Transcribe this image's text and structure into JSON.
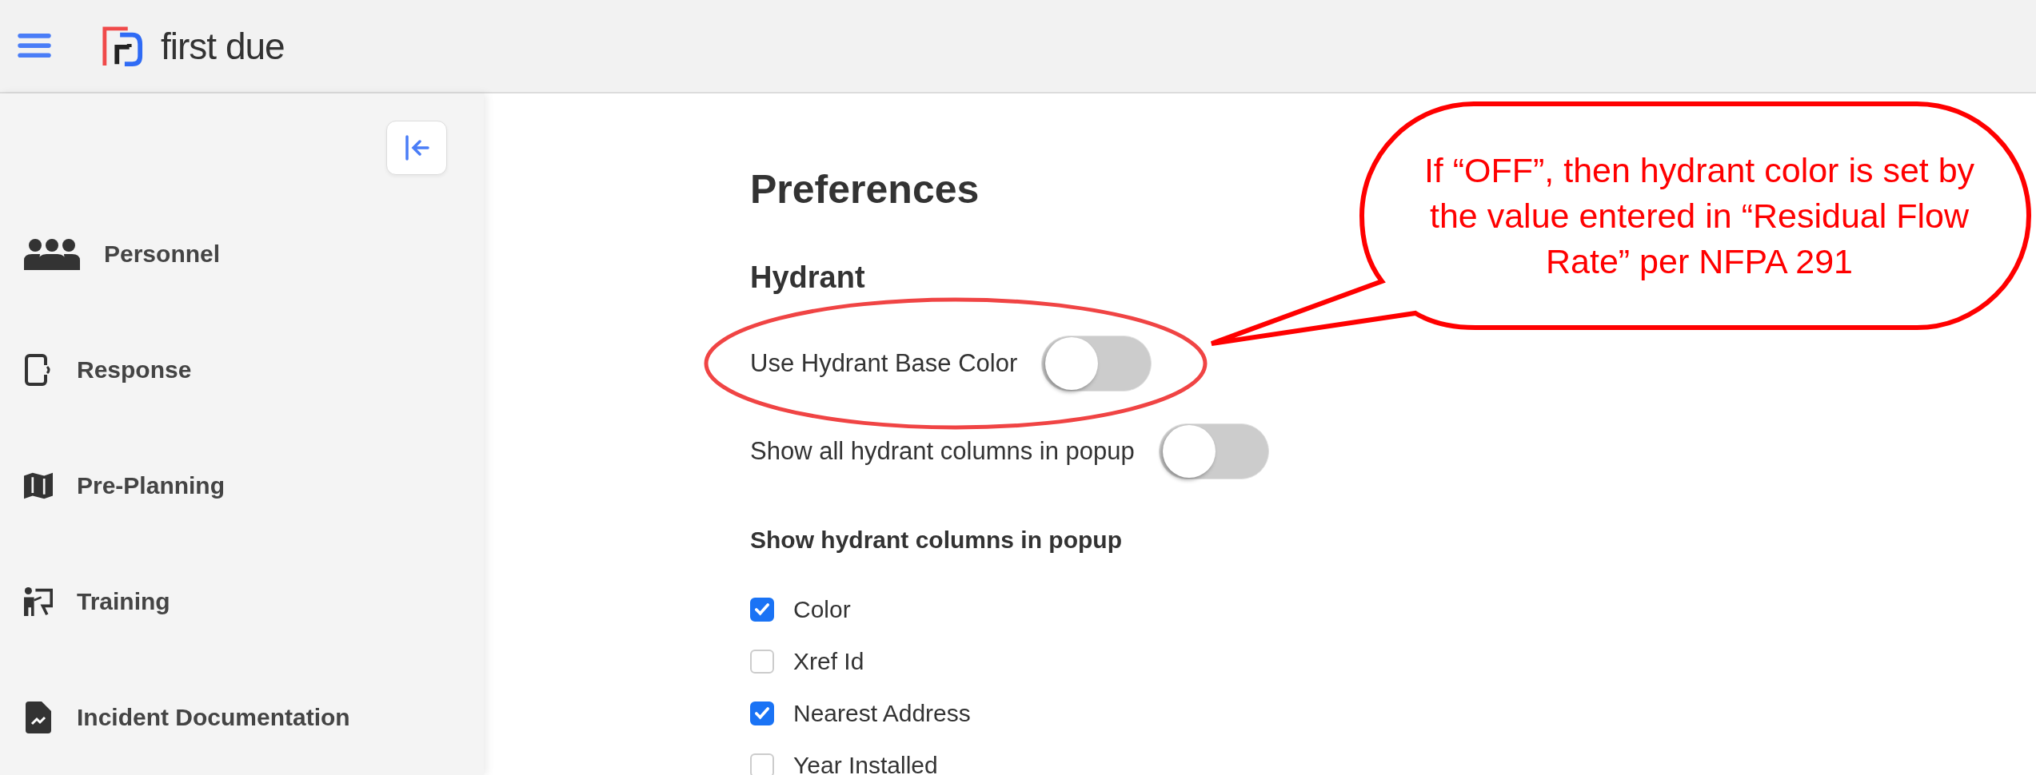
{
  "header": {
    "brand": "first due"
  },
  "sidebar": {
    "items": [
      {
        "label": "Personnel",
        "kind": "people"
      },
      {
        "label": "Response",
        "kind": "device"
      },
      {
        "label": "Pre-Planning",
        "kind": "map"
      },
      {
        "label": "Training",
        "kind": "trainer"
      },
      {
        "label": "Incident Documentation",
        "kind": "document"
      }
    ]
  },
  "main": {
    "title": "Preferences",
    "section": "Hydrant",
    "toggles": [
      {
        "label": "Use Hydrant Base Color",
        "on": false
      },
      {
        "label": "Show all hydrant columns in popup",
        "on": false
      }
    ],
    "columns_heading": "Show hydrant columns in popup",
    "columns": [
      {
        "label": "Color",
        "checked": true
      },
      {
        "label": "Xref Id",
        "checked": false
      },
      {
        "label": "Nearest Address",
        "checked": true
      },
      {
        "label": "Year Installed",
        "checked": false
      }
    ]
  },
  "annotation": {
    "callout": "If “OFF”, then hydrant color is set by the value entered in “Residual Flow Rate” per NFPA 291"
  }
}
